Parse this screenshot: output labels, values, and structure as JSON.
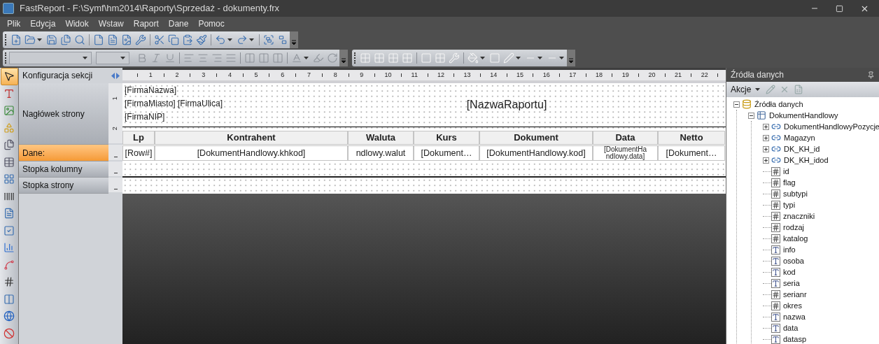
{
  "window": {
    "title": "FastReport - F:\\Symf\\hm2014\\Raporty\\Sprzedaż - dokumenty.frx"
  },
  "menu": [
    "Plik",
    "Edycja",
    "Widok",
    "Wstaw",
    "Raport",
    "Dane",
    "Pomoc"
  ],
  "tools": [
    {
      "kind": "pointer",
      "selected": true
    },
    {
      "kind": "text",
      "selected": false
    },
    {
      "kind": "picture",
      "selected": false
    },
    {
      "kind": "shapes",
      "selected": false
    },
    {
      "kind": "subreport",
      "selected": false
    },
    {
      "kind": "table",
      "selected": false
    },
    {
      "kind": "matrix",
      "selected": false
    },
    {
      "kind": "barcode",
      "selected": false
    },
    {
      "kind": "richtext",
      "selected": false
    },
    {
      "kind": "checkbox",
      "selected": false
    },
    {
      "kind": "chart",
      "selected": false
    },
    {
      "kind": "sparkline",
      "selected": false
    },
    {
      "kind": "digits",
      "selected": false
    },
    {
      "kind": "celltext",
      "selected": false
    },
    {
      "kind": "globe",
      "selected": false
    },
    {
      "kind": "stop",
      "selected": false
    }
  ],
  "sections_header": "Konfiguracja sekcji",
  "sections": [
    {
      "label": "Nagłówek strony",
      "kind": "page_header",
      "selected": false
    },
    {
      "label": "Dane:",
      "kind": "data",
      "selected": true
    },
    {
      "label": "Stopka kolumny",
      "kind": "column_footer",
      "selected": false
    },
    {
      "label": "Stopka strony",
      "kind": "page_footer",
      "selected": false
    }
  ],
  "ruler": [
    "1",
    "2",
    "3",
    "4",
    "5",
    "6",
    "7",
    "8",
    "9",
    "10",
    "11",
    "12",
    "13",
    "14",
    "15",
    "16",
    "17",
    "18",
    "19",
    "20",
    "21",
    "22"
  ],
  "vruler": [
    "1",
    "2"
  ],
  "report": {
    "header_lines": [
      "[FirmaNazwa]",
      "[FirmaMiasto] [FirmaUlica]",
      "[FirmaNIP]"
    ],
    "title": "[NazwaRaportu]",
    "columns": [
      {
        "header": "Lp",
        "cell": [
          "[Row#]"
        ]
      },
      {
        "header": "Kontrahent",
        "cell": [
          "[DokumentHandlowy.khkod]"
        ]
      },
      {
        "header": "Waluta",
        "cell": [
          "ndlowy.walut"
        ]
      },
      {
        "header": "Kurs",
        "cell": [
          "[Dokument…"
        ]
      },
      {
        "header": "Dokument",
        "cell": [
          "[DokumentHandlowy.kod]"
        ]
      },
      {
        "header": "Data",
        "cell": [
          "[DokumentHa",
          "ndlowy.data]"
        ]
      },
      {
        "header": "Netto",
        "cell": [
          "[Dokument…"
        ]
      }
    ]
  },
  "data_panel": {
    "title": "Źródła danych",
    "actions": "Akcje",
    "tree": [
      {
        "label": "Źródła danych",
        "kind": "datasource",
        "expanded": true,
        "children": [
          {
            "label": "DokumentHandlowy",
            "kind": "table",
            "expanded": true,
            "children": [
              {
                "label": "DokumentHandlowyPozycje",
                "kind": "relation",
                "expanded": false
              },
              {
                "label": "Magazyn",
                "kind": "relation",
                "expanded": false
              },
              {
                "label": "DK_KH_id",
                "kind": "relation",
                "expanded": false
              },
              {
                "label": "DK_KH_idod",
                "kind": "relation",
                "expanded": false
              },
              {
                "label": "id",
                "kind": "number"
              },
              {
                "label": "flag",
                "kind": "number"
              },
              {
                "label": "subtypi",
                "kind": "number"
              },
              {
                "label": "typi",
                "kind": "number"
              },
              {
                "label": "znaczniki",
                "kind": "number"
              },
              {
                "label": "rodzaj",
                "kind": "number"
              },
              {
                "label": "katalog",
                "kind": "number"
              },
              {
                "label": "info",
                "kind": "text"
              },
              {
                "label": "osoba",
                "kind": "text"
              },
              {
                "label": "kod",
                "kind": "text"
              },
              {
                "label": "seria",
                "kind": "text"
              },
              {
                "label": "serianr",
                "kind": "number"
              },
              {
                "label": "okres",
                "kind": "number"
              },
              {
                "label": "nazwa",
                "kind": "text"
              },
              {
                "label": "data",
                "kind": "text"
              },
              {
                "label": "datasp",
                "kind": "text"
              }
            ]
          }
        ]
      }
    ]
  }
}
